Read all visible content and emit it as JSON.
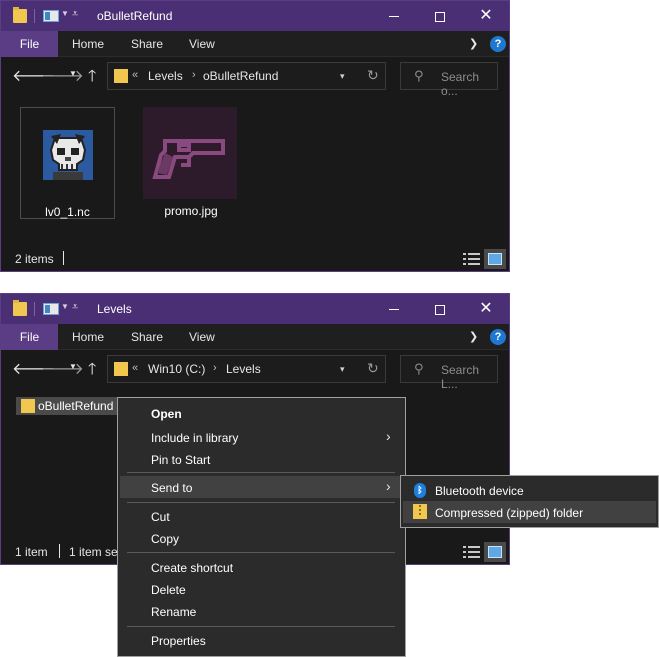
{
  "window1": {
    "title": "oBulletRefund",
    "ribbon": {
      "file": "File",
      "home": "Home",
      "share": "Share",
      "view": "View"
    },
    "address": {
      "chevrons": "«",
      "segments": [
        "Levels",
        "oBulletRefund"
      ],
      "separator": "›"
    },
    "search_placeholder": "Search o...",
    "files": [
      {
        "name": "lv0_1.nc"
      },
      {
        "name": "promo.jpg"
      }
    ],
    "status": "2 items"
  },
  "window2": {
    "title": "Levels",
    "ribbon": {
      "file": "File",
      "home": "Home",
      "share": "Share",
      "view": "View"
    },
    "address": {
      "chevrons": "«",
      "segments": [
        "Win10 (C:)",
        "Levels"
      ],
      "separator": "›"
    },
    "search_placeholder": "Search L...",
    "folder": {
      "name": "oBulletRefund"
    },
    "status": "1 item",
    "status_selected": "1 item se"
  },
  "context_menu": {
    "items": [
      "Open",
      "Include in library",
      "Pin to Start",
      "Send to",
      "Cut",
      "Copy",
      "Create shortcut",
      "Delete",
      "Rename",
      "Properties"
    ]
  },
  "send_to_menu": {
    "items": [
      "Bluetooth device",
      "Compressed (zipped) folder"
    ]
  },
  "colors": {
    "titlebar": "#4b2f74",
    "file_tab": "#5b3d86",
    "window_bg": "#191919",
    "menu_bg": "#2b2b2b",
    "menu_highlight": "#414141"
  },
  "icons": [
    "folder-icon",
    "back-arrow-icon",
    "forward-arrow-icon",
    "up-arrow-icon",
    "refresh-icon",
    "search-icon",
    "help-icon",
    "bluetooth-icon",
    "zip-folder-icon",
    "chevron-right-icon"
  ]
}
